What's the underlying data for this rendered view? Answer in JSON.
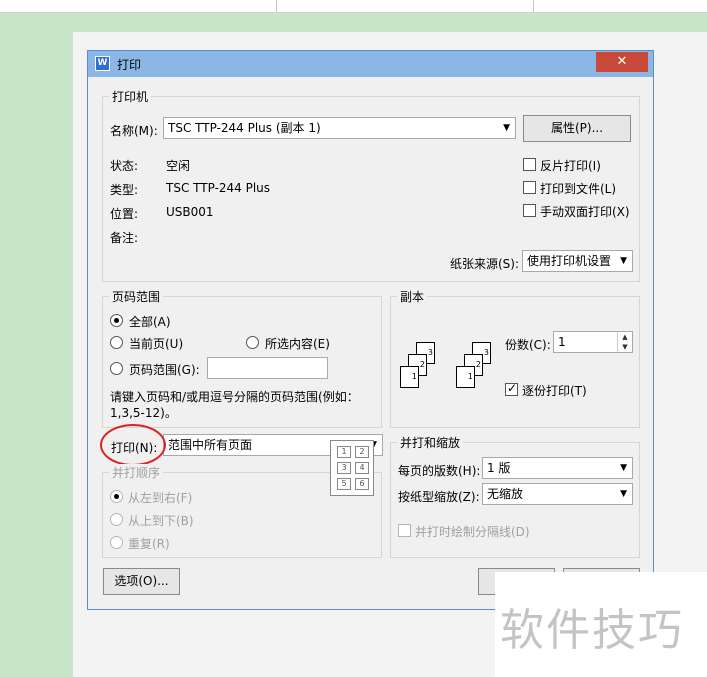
{
  "window": {
    "title": "打印",
    "close_glyph": "✕",
    "app_icon_glyph": "W"
  },
  "printer": {
    "group_title": "打印机",
    "name_label": "名称(M):",
    "name_value": "TSC TTP-244 Plus (副本 1)",
    "properties_button": "属性(P)...",
    "status_label": "状态:",
    "status_value": "空闲",
    "type_label": "类型:",
    "type_value": "TSC TTP-244 Plus",
    "location_label": "位置:",
    "location_value": "USB001",
    "comment_label": "备注:",
    "reverse_print": "反片打印(I)",
    "print_to_file": "打印到文件(L)",
    "manual_duplex": "手动双面打印(X)",
    "paper_source_label": "纸张来源(S):",
    "paper_source_value": "使用打印机设置"
  },
  "page_range": {
    "group_title": "页码范围",
    "all": "全部(A)",
    "current_page": "当前页(U)",
    "selection": "所选内容(E)",
    "pages": "页码范围(G):",
    "hint": "请键入页码和/或用逗号分隔的页码范围(例如：",
    "hint2": "1,3,5-12)。"
  },
  "copies": {
    "group_title": "副本",
    "count_label": "份数(C):",
    "count_value": "1",
    "collate": "逐份打印(T)",
    "collate_checked": true
  },
  "print_what": {
    "label": "打印(N):",
    "value": "范围中所有页面"
  },
  "print_order": {
    "group_title": "并打顺序",
    "left_to_right": "从左到右(F)",
    "top_to_bottom": "从上到下(B)",
    "repeat": "重复(R)",
    "grid": [
      "1",
      "2",
      "3",
      "4",
      "5",
      "6"
    ]
  },
  "zoom": {
    "group_title": "并打和缩放",
    "pages_per_sheet_label": "每页的版数(H):",
    "pages_per_sheet_value": "1 版",
    "scale_label": "按纸型缩放(Z):",
    "scale_value": "无缩放",
    "draw_borders": "并打时绘制分隔线(D)"
  },
  "footer": {
    "options_button": "选项(O)..."
  },
  "watermark": {
    "text": "软件技巧"
  },
  "stack_labels": {
    "a": [
      "3",
      "2",
      "1"
    ],
    "b": [
      "3",
      "2",
      "1"
    ]
  },
  "colors": {
    "titlebar": "#8cb6e6",
    "close": "#c94a3b",
    "annotation": "#e02020"
  }
}
